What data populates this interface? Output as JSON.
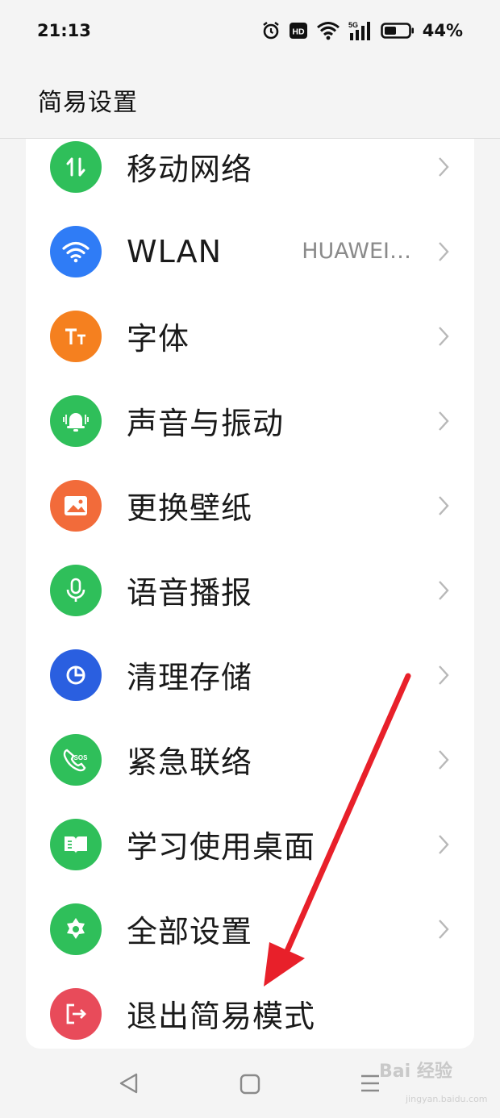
{
  "status_bar": {
    "time": "21:13",
    "battery_percent": "44%",
    "indicators": [
      "alarm-icon",
      "hd-icon",
      "wifi-icon",
      "signal-5g-icon",
      "battery-icon"
    ],
    "hd_label": "HD",
    "network_label": "5G"
  },
  "header": {
    "title": "简易设置"
  },
  "settings": {
    "items": [
      {
        "label": "移动网络",
        "value": "",
        "icon": "mobile-data-icon",
        "color": "#2fbf5a"
      },
      {
        "label": "WLAN",
        "value": "HUAWEI…",
        "icon": "wifi-icon",
        "color": "#2f7cf6"
      },
      {
        "label": "字体",
        "value": "",
        "icon": "font-icon",
        "color": "#f5801f"
      },
      {
        "label": "声音与振动",
        "value": "",
        "icon": "bell-icon",
        "color": "#2fbf5a"
      },
      {
        "label": "更换壁纸",
        "value": "",
        "icon": "image-icon",
        "color": "#f26b3a"
      },
      {
        "label": "语音播报",
        "value": "",
        "icon": "microphone-icon",
        "color": "#2fbf5a"
      },
      {
        "label": "清理存储",
        "value": "",
        "icon": "storage-pie-icon",
        "color": "#2a5fe0"
      },
      {
        "label": "紧急联络",
        "value": "",
        "icon": "sos-phone-icon",
        "color": "#2fbf5a"
      },
      {
        "label": "学习使用桌面",
        "value": "",
        "icon": "book-icon",
        "color": "#2fbf5a"
      },
      {
        "label": "全部设置",
        "value": "",
        "icon": "gear-icon",
        "color": "#2fbf5a"
      },
      {
        "label": "退出简易模式",
        "value": "",
        "icon": "exit-icon",
        "color": "#e84b5a"
      }
    ]
  },
  "navigation": {
    "buttons": [
      "back-icon",
      "home-icon",
      "menu-icon"
    ]
  },
  "watermark": {
    "text": "Bai 经验",
    "sub": "jingyan.baidu.com"
  },
  "annotation": {
    "arrow_color": "#e8202a"
  }
}
